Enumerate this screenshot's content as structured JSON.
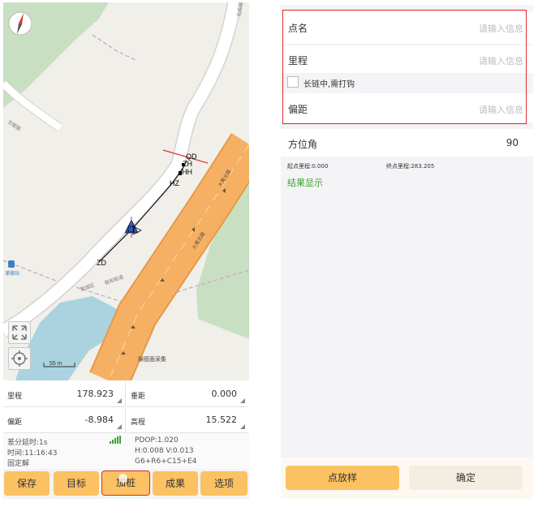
{
  "left": {
    "map": {
      "stake_labels": {
        "qd": "QD",
        "zh": "ZH",
        "hh": "HH",
        "hz": "HZ",
        "zd": "ZD"
      },
      "scale_label": "55 m",
      "place_label": "锦德面采集",
      "road_label_1": "大青北路",
      "road_label_2": "大青北路",
      "district_label": "新城区",
      "district_label_2": "联和街道",
      "road_label_top": "北成路",
      "road_label_left": "北壁路",
      "station_label": "浦德站"
    },
    "fields": {
      "mileage": {
        "label": "里程",
        "value": "178.923"
      },
      "vertical": {
        "label": "垂距",
        "value": "0.000"
      },
      "offset": {
        "label": "偏距",
        "value": "-8.984"
      },
      "elevation": {
        "label": "高程",
        "value": "15.522"
      }
    },
    "status": {
      "diff_delay": "差分延时:1s",
      "time": "时间:11:16:43",
      "solution": "固定解",
      "pdop": "PDOP:1.020",
      "hv": "H:0.008  V:0.013",
      "sats": "G6+R6+C15+E4"
    },
    "buttons": {
      "save": "保存",
      "target": "目标",
      "add_stake": "加桩",
      "results": "成果",
      "options": "选项"
    }
  },
  "right": {
    "form": {
      "point_name": {
        "label": "点名",
        "placeholder": "请输入信息"
      },
      "mileage": {
        "label": "里程",
        "placeholder": "请输入信息"
      },
      "checkbox_label": "长链中,需打钩",
      "offset": {
        "label": "偏距",
        "placeholder": "请输入信息"
      }
    },
    "azimuth": {
      "label": "方位角",
      "value": "90"
    },
    "start_mileage": "起点里程:0.000",
    "end_mileage": "终点里程:283.205",
    "result_label": "结果显示",
    "buttons": {
      "stakeout": "点放样",
      "confirm": "确定"
    }
  },
  "colors": {
    "button_yellow": "#fbc163",
    "highlight_red": "#e02a2a",
    "result_green": "#3aa52f",
    "map_green": "#c9dfc2",
    "map_water": "#aad3df",
    "main_road": "#f6b064"
  },
  "icons": [
    "compass-icon",
    "expand-icon",
    "locate-icon",
    "signal-icon",
    "checkbox-icon",
    "position-marker-icon"
  ]
}
